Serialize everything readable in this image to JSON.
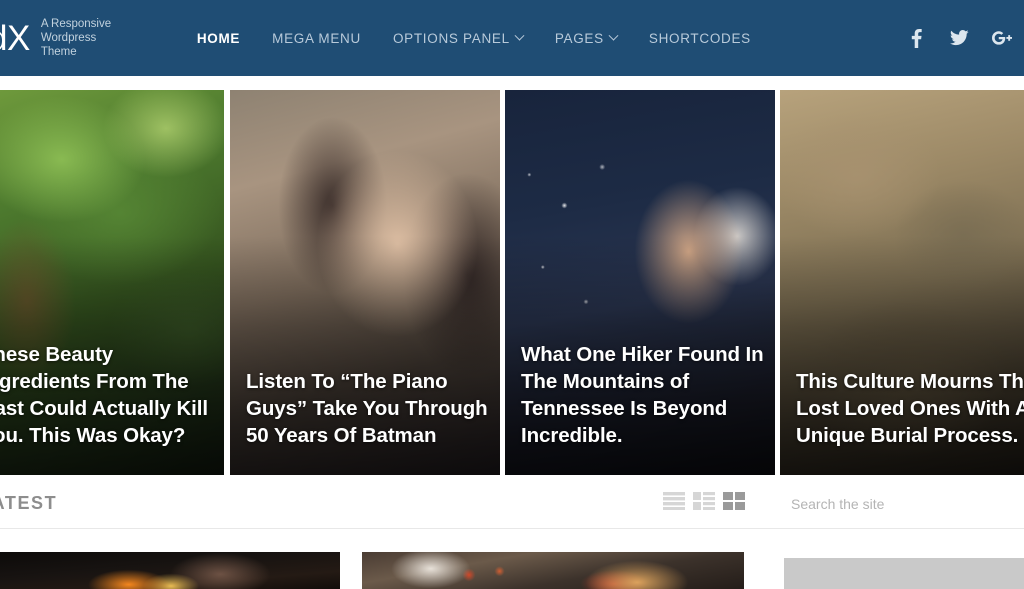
{
  "header": {
    "logo_text": "dX",
    "tagline_line1": "A Responsive",
    "tagline_line2": "Wordpress Theme",
    "background_color": "#1f4d74",
    "nav": [
      {
        "label": "HOME",
        "active": true,
        "has_dropdown": false
      },
      {
        "label": "MEGA MENU",
        "active": false,
        "has_dropdown": false
      },
      {
        "label": "OPTIONS PANEL",
        "active": false,
        "has_dropdown": true
      },
      {
        "label": "PAGES",
        "active": false,
        "has_dropdown": true
      },
      {
        "label": "SHORTCODES",
        "active": false,
        "has_dropdown": false
      }
    ],
    "social": [
      {
        "name": "facebook-icon",
        "label": "f"
      },
      {
        "name": "twitter-icon",
        "label": "t"
      },
      {
        "name": "google-plus-icon",
        "label": "G+"
      }
    ]
  },
  "slider": {
    "slides": [
      {
        "title": "These Beauty Ingredients From The Past Could Actually Kill You. This Was Okay?",
        "image": "forest-tree-canopy"
      },
      {
        "title": "Listen To “The Piano Guys” Take You Through 50 Years Of Batman",
        "image": "woman-with-sunglasses-portrait"
      },
      {
        "title": "What One Hiker Found In The Mountains of Tennessee Is Beyond Incredible.",
        "image": "woman-blowing-snow-winter"
      },
      {
        "title": "This Culture Mourns Their Lost Loved Ones With A Unique Burial Process.",
        "image": "soldiers-in-desert"
      }
    ]
  },
  "latest": {
    "heading": "LATEST",
    "view_toggles": [
      {
        "name": "list-view-toggle",
        "active": false
      },
      {
        "name": "list-thumb-view-toggle",
        "active": false
      },
      {
        "name": "grid-view-toggle",
        "active": true
      }
    ],
    "search_placeholder": "Search the site",
    "search_value": ""
  },
  "content": {
    "cards": [
      {
        "name": "post-card-grill",
        "image": "grill-fire-bbq"
      },
      {
        "name": "post-card-pizza",
        "image": "pizza-on-table"
      }
    ],
    "sidebar_widget": {
      "name": "sidebar-widget-placeholder"
    }
  }
}
